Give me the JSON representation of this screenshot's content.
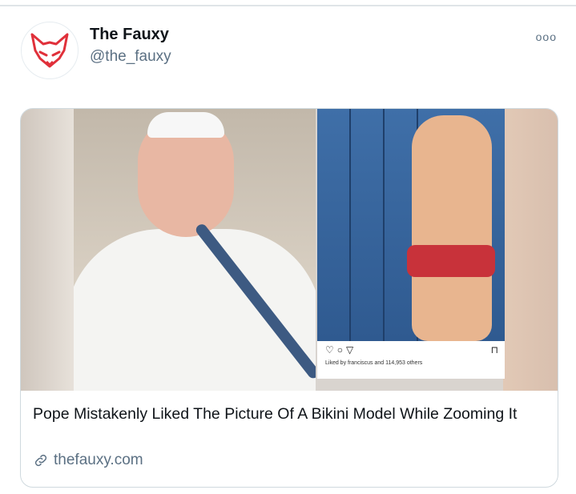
{
  "account": {
    "name": "The Fauxy",
    "handle": "@the_fauxy",
    "avatar_icon": "fox-logo-icon",
    "more_icon": "more-options-icon",
    "more_glyph": "ooo"
  },
  "card": {
    "headline": "Pope Mistakenly Liked The Picture Of A Bikini Model While Zooming It",
    "link_icon": "link-icon",
    "domain": "thefauxy.com",
    "media": {
      "instagram_liked_text": "Liked by franciscus and 114,953 others"
    }
  },
  "colors": {
    "brand_red": "#e0303a",
    "text_primary": "#0f1419",
    "text_secondary": "#5b7083",
    "border": "#cfd9de"
  }
}
